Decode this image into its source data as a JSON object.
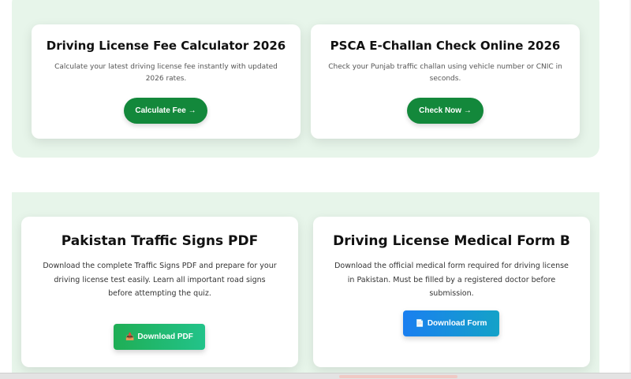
{
  "cards_top": [
    {
      "title": "Driving License Fee Calculator 2026",
      "description": "Calculate your latest driving license fee instantly with updated 2026 rates.",
      "button": "Calculate Fee →"
    },
    {
      "title": "PSCA E-Challan Check Online 2026",
      "description": "Check your Punjab traffic challan using vehicle number or CNIC in seconds.",
      "button": "Check Now →"
    }
  ],
  "cards_bottom": [
    {
      "title": "Pakistan Traffic Signs PDF",
      "description": "Download the complete Traffic Signs PDF and prepare for your driving license test easily. Learn all important road signs before attempting the quiz.",
      "button": "Download PDF",
      "button_icon": "📥"
    },
    {
      "title": "Driving License Medical Form B",
      "description": "Download the official medical form required for driving license in Pakistan. Must be filled by a registered doctor before submission.",
      "button": "Download Form",
      "button_icon": "📄"
    }
  ],
  "colors": {
    "section_bg": "#e7f5ea",
    "primary_green": "#13883b",
    "download_green": "#1fae55",
    "download_blue": "#1a7ff0"
  }
}
